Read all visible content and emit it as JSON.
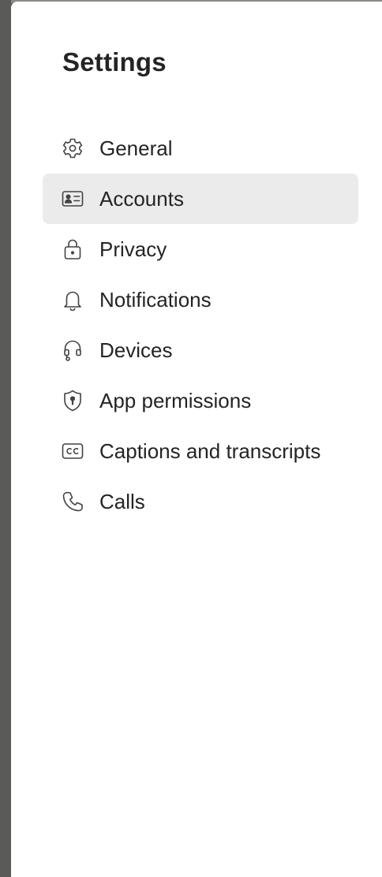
{
  "settings": {
    "title": "Settings",
    "items": [
      {
        "label": "General",
        "icon": "gear-icon",
        "selected": false
      },
      {
        "label": "Accounts",
        "icon": "id-card-icon",
        "selected": true
      },
      {
        "label": "Privacy",
        "icon": "lock-icon",
        "selected": false
      },
      {
        "label": "Notifications",
        "icon": "bell-icon",
        "selected": false
      },
      {
        "label": "Devices",
        "icon": "headset-icon",
        "selected": false
      },
      {
        "label": "App permissions",
        "icon": "shield-icon",
        "selected": false
      },
      {
        "label": "Captions and transcripts",
        "icon": "closed-captions-icon",
        "selected": false
      },
      {
        "label": "Calls",
        "icon": "phone-icon",
        "selected": false
      }
    ],
    "colors": {
      "selected_background": "#ebebeb",
      "text": "#242424",
      "icon": "#424242"
    }
  }
}
